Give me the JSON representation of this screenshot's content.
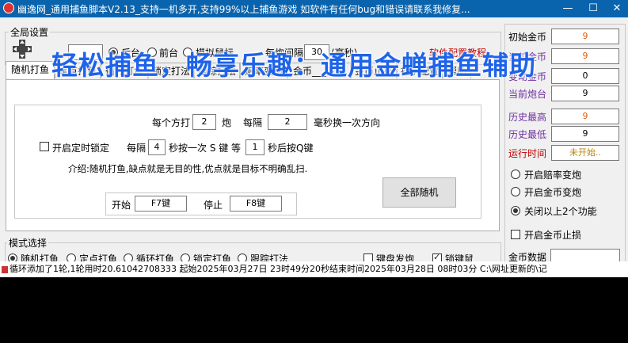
{
  "window": {
    "title": "幽逸网_通用捕鱼脚本V2.13_支持一机多开,支持99%以上捕鱼游戏  如软件有任何bug和错误请联系我修复...",
    "min": "—",
    "max": "☐",
    "close": "✕"
  },
  "global": {
    "label": "全局设置",
    "mode_back": "后台",
    "mode_front": "前台",
    "mode_sim": "模拟鼠标",
    "every_interval": "每炮间隔",
    "interval_value": "30",
    "ms": "(毫秒)",
    "config_tutorial": "软件配置教程"
  },
  "overlay": "轻松捕鱼，畅享乐趣：通用金蝉捕鱼辅助",
  "tabs": [
    "随机打鱼",
    "定点打鱼",
    "循环打鱼",
    "锁定打法",
    "跟踪打法",
    "赔率变炮",
    "金币___变炮",
    "金币止损",
    "挂机配置",
    "帮助"
  ],
  "random": {
    "per_dir": "每个方打",
    "shots": "2",
    "pao": "炮",
    "every": "每隔",
    "ms_val": "2",
    "ms_change": "毫秒换一次方向",
    "timer_lock": "开启定时锁定",
    "every2": "每隔",
    "sec_val": "4",
    "press_s": "秒按一次 S 键 等",
    "wait_val": "1",
    "press_q": "秒后按Q键",
    "intro": "介绍:随机打鱼,缺点就是无目的性,优点就是目标不明确乱扫.",
    "start_label": "开始",
    "start_key": "F7键",
    "stop_label": "停止",
    "stop_key": "F8键",
    "all_random": "全部随机"
  },
  "mode_select": {
    "label": "模式选择",
    "items": [
      "随机打鱼",
      "定点打鱼",
      "循环打鱼",
      "锁定打鱼",
      "跟踪打法"
    ],
    "keyboard_fire": "键盘发炮",
    "lock_key": "锁键鼠"
  },
  "stats": {
    "initial_gold_label": "初始金币",
    "initial_gold": "9",
    "current_gold_label": "当前金币",
    "current_gold": "9",
    "changed_gold_label": "变动金币",
    "changed_gold": "0",
    "current_cannon_label": "当前炮台",
    "current_cannon": "9",
    "hist_high_label": "历史最高",
    "hist_high": "9",
    "hist_low_label": "历史最低",
    "hist_low": "9",
    "run_time_label": "运行时间",
    "run_time": "未开始..",
    "opt1": "开启赔率变炮",
    "opt2": "开启金币变炮",
    "opt3": "关闭以上2个功能",
    "stop_loss": "开启金币止损",
    "gold_data": "金币数据"
  },
  "status": "循环添加了1轮,1轮用时20.61042708333   起始2025年03月27日  23时49分20秒结束时间2025年03月28日  08时03分 C:\\网址更新的\\记",
  "colors": {
    "title_bar": "#0a64ad",
    "overlay_text": "#1e63e9",
    "stat_label": "#7030a0",
    "gold_value": "#e65c00"
  }
}
